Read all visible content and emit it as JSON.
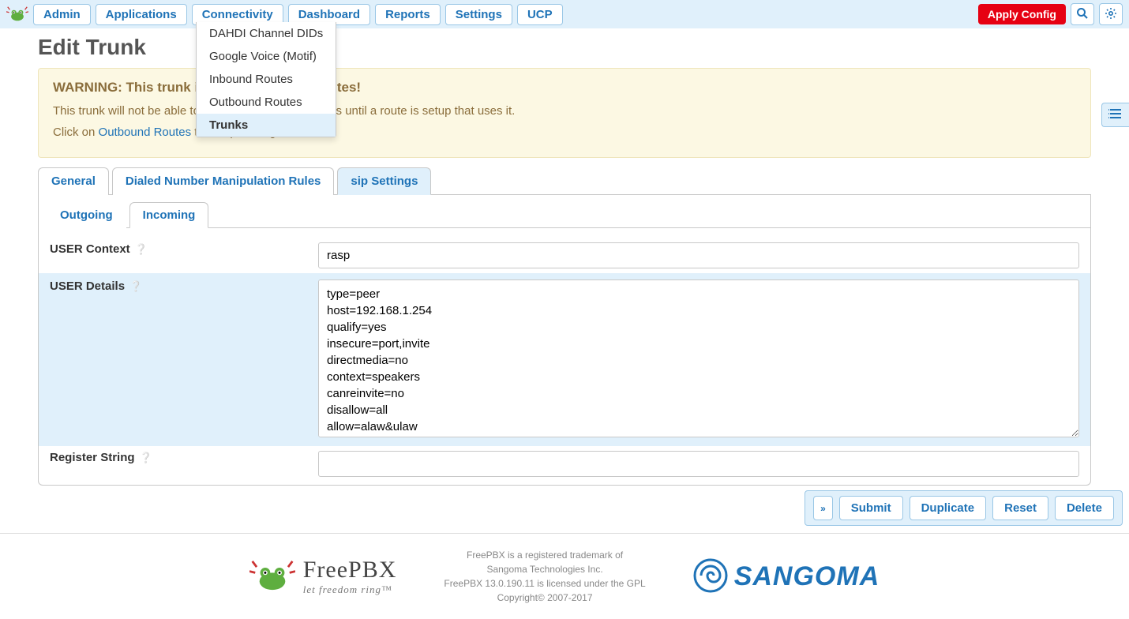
{
  "nav": {
    "items": [
      "Admin",
      "Applications",
      "Connectivity",
      "Dashboard",
      "Reports",
      "Settings",
      "UCP"
    ],
    "apply": "Apply Config"
  },
  "dropdown": {
    "items": [
      "DAHDI Channel DIDs",
      "Google Voice (Motif)",
      "Inbound Routes",
      "Outbound Routes",
      "Trunks"
    ]
  },
  "page": {
    "title": "Edit Trunk",
    "warning": {
      "heading": "WARNING: This trunk is not used by any routes!",
      "line1": "This trunk will not be able to be used for outbound calls until a route is setup that uses it.",
      "line2a": "Click on ",
      "link": "Outbound Routes",
      "line2b": " to setup routing."
    },
    "tabs": [
      "General",
      "Dialed Number Manipulation Rules",
      "sip Settings"
    ],
    "subtabs": [
      "Outgoing",
      "Incoming"
    ],
    "fields": {
      "user_context": {
        "label": "USER Context",
        "value": "rasp"
      },
      "user_details": {
        "label": "USER Details",
        "value": "type=peer\nhost=192.168.1.254\nqualify=yes\ninsecure=port,invite\ndirectmedia=no\ncontext=speakers\ncanreinvite=no\ndisallow=all\nallow=alaw&ulaw"
      },
      "register_string": {
        "label": "Register String",
        "value": ""
      }
    }
  },
  "footer_btns": [
    "Submit",
    "Duplicate",
    "Reset",
    "Delete"
  ],
  "footer": {
    "freepbx": "FreePBX",
    "tagline": "let freedom ring™",
    "line1": "FreePBX is a registered trademark of",
    "line2": "Sangoma Technologies Inc.",
    "line3": "FreePBX 13.0.190.11 is licensed under the GPL",
    "line4": "Copyright© 2007-2017",
    "sangoma": "SANGOMA"
  }
}
